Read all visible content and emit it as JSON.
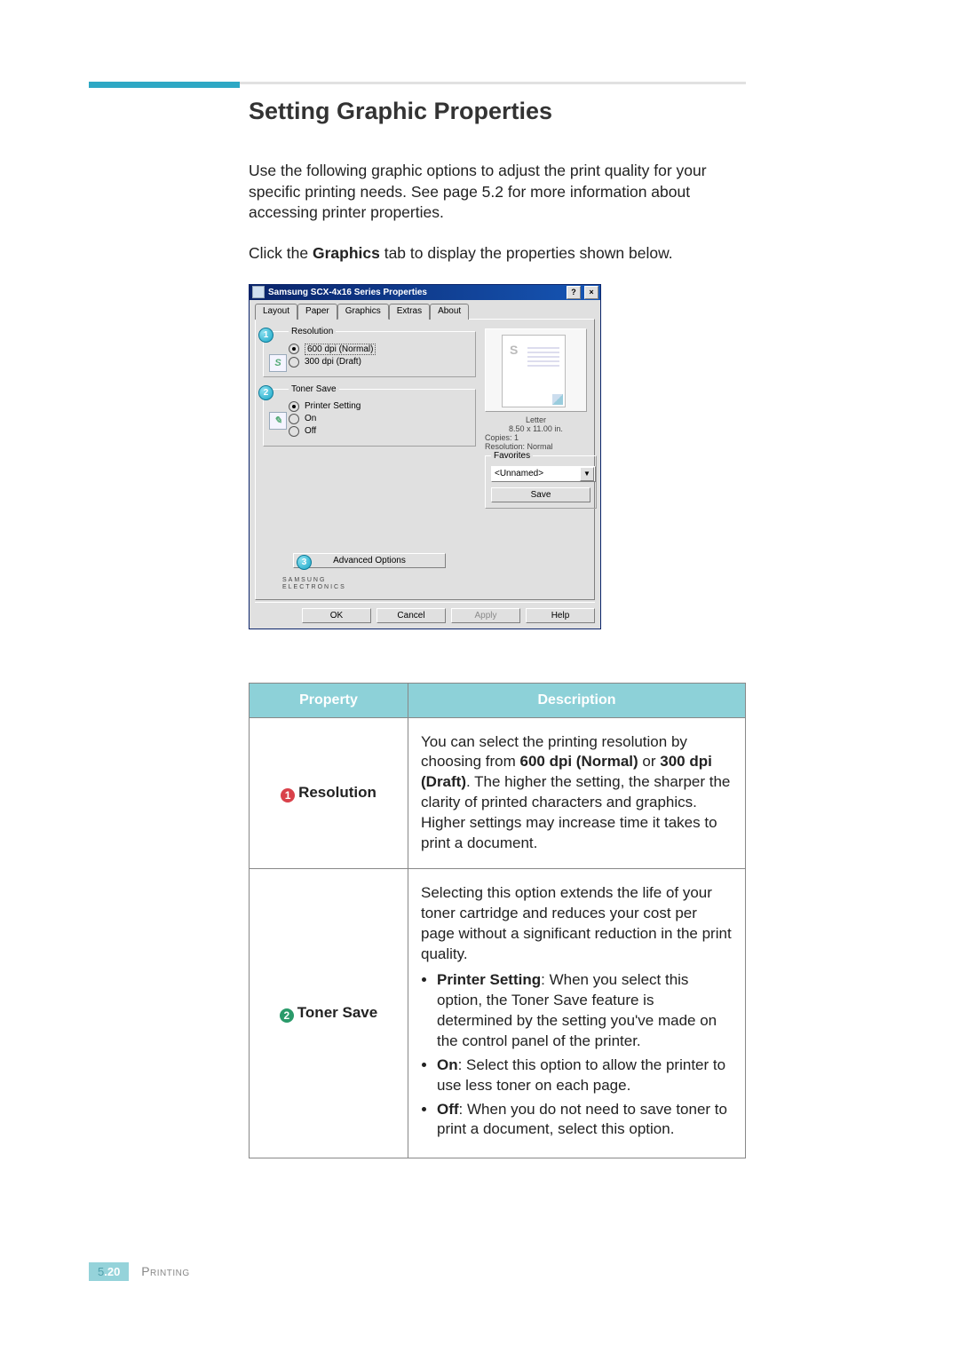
{
  "heading": "Setting Graphic Properties",
  "intro": "Use the following graphic options to adjust the print quality for your specific printing needs. See page 5.2 for more information about accessing printer properties.",
  "click_line_before": "Click the ",
  "click_line_bold": "Graphics",
  "click_line_after": " tab to display the properties shown below.",
  "dialog": {
    "title": "Samsung SCX-4x16 Series Properties",
    "help_btn": "?",
    "close_btn": "×",
    "tabs": [
      "Layout",
      "Paper",
      "Graphics",
      "Extras",
      "About"
    ],
    "active_tab_index": 2,
    "resolution": {
      "legend": "Resolution",
      "icon_text": "S",
      "options": [
        "600 dpi (Normal)",
        "300 dpi (Draft)"
      ],
      "selected_index": 0,
      "callout": "1"
    },
    "toner_save": {
      "legend": "Toner Save",
      "options": [
        "Printer Setting",
        "On",
        "Off"
      ],
      "selected_index": 0,
      "callout": "2"
    },
    "advanced": {
      "label": "Advanced Options",
      "callout": "3"
    },
    "preview": {
      "paper_name": "Letter",
      "paper_size": "8.50 x 11.00 in.",
      "copies": "Copies: 1",
      "resolution": "Resolution: Normal"
    },
    "favorites": {
      "legend": "Favorites",
      "value": "<Unnamed>",
      "save_label": "Save"
    },
    "brand_line1": "SAMSUNG",
    "brand_line2": "ELECTRONICS",
    "buttons": {
      "ok": "OK",
      "cancel": "Cancel",
      "apply": "Apply",
      "help": "Help"
    }
  },
  "table": {
    "headers": {
      "property": "Property",
      "description": "Description"
    },
    "row1": {
      "num": "1",
      "name": "Resolution",
      "desc_before": "You can select the printing resolution by choosing from ",
      "bold1": "600 dpi (Normal)",
      "mid": " or ",
      "bold2": "300 dpi (Draft)",
      "desc_after": ". The higher the setting, the sharper the clarity of printed characters and graphics. Higher settings may increase time it takes to print a document."
    },
    "row2": {
      "num": "2",
      "name": "Toner Save",
      "desc_intro": "Selecting this option extends the life of your toner cartridge and reduces your cost per page without a significant reduction in the print quality.",
      "items": {
        "a_bold": "Printer Setting",
        "a_rest": ": When you select this option, the Toner Save feature is determined by the setting you've made on the control panel of the printer.",
        "b_bold": "On",
        "b_rest": ": Select this option to allow the printer to use less toner on each page.",
        "c_bold": "Off",
        "c_rest": ": When you do not need to save toner to print a document, select this option."
      }
    }
  },
  "footer": {
    "chapter": "5",
    "dot": ".",
    "page": "20",
    "section": "Printing"
  }
}
